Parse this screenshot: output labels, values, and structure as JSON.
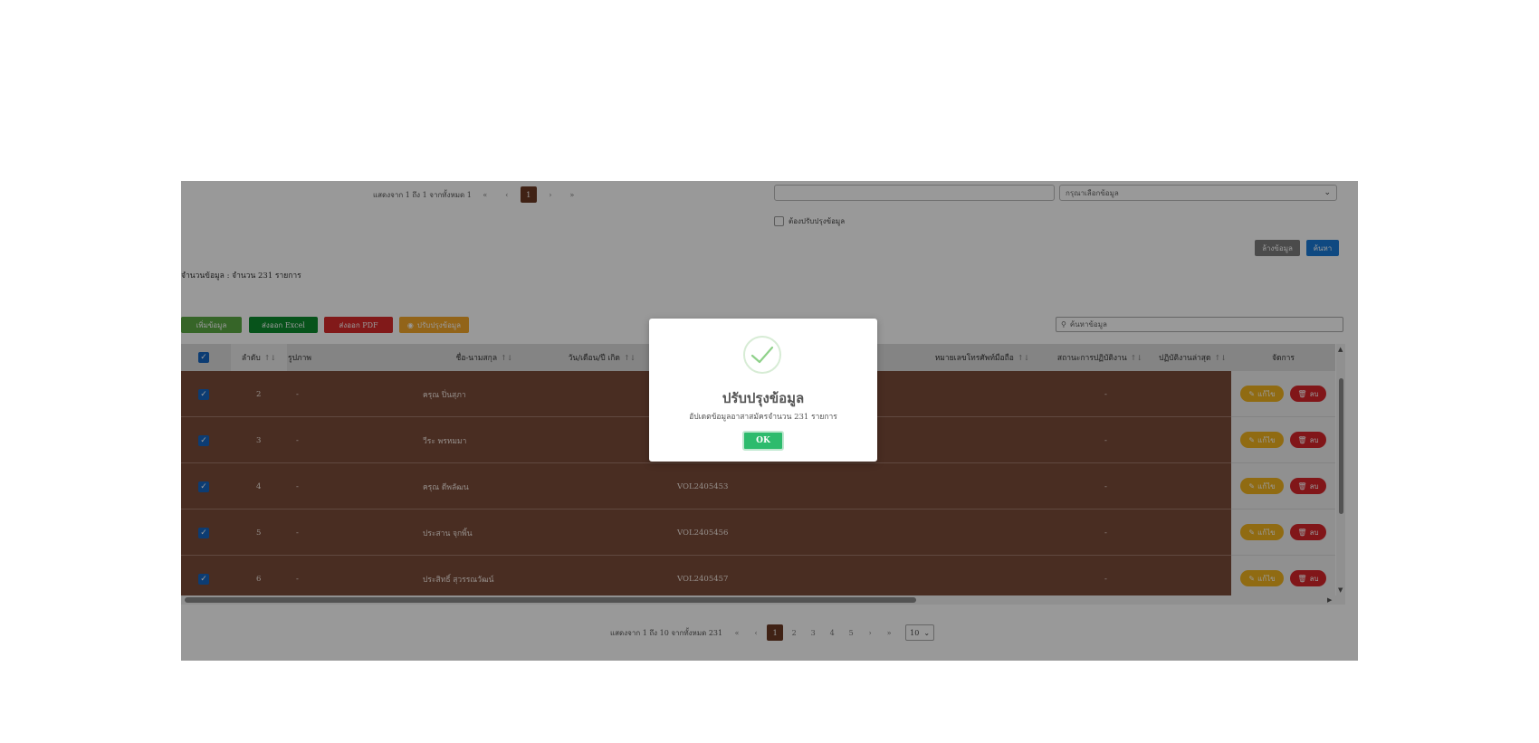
{
  "top_filter": {
    "pager_text": "แสดงจาก 1 ถึง 1 จากทั้งหมด 1",
    "pager_first": "«",
    "pager_prev": "‹",
    "pager_current": "1",
    "pager_next": "›",
    "pager_last": "»",
    "text_input_value": "",
    "select_placeholder": "กรุณาเลือกข้อมูล",
    "checkbox_label": "ต้องปรับปรุงข้อมูล",
    "clear_button": "ล้างข้อมูล",
    "search_button": "ค้นหา"
  },
  "summary": {
    "label": "จำนวนข้อมูล :",
    "value": "จำนวน 231 รายการ"
  },
  "toolbar": {
    "add_button": "เพิ่มข้อมูล",
    "export_excel": "ส่งออก Excel",
    "export_pdf": "ส่งออก PDF",
    "update_button": "ปรับปรุงข้อมูล",
    "search_placeholder": "ค้นหาข้อมูล"
  },
  "table": {
    "headers": {
      "order": "ลำดับ",
      "photo": "รูปภาพ",
      "name": "ชื่อ-นามสกุล",
      "birthdate": "วัน/เดือน/ปี เกิด",
      "phone": "หมายเลขโทรศัพท์มือถือ",
      "status": "สถานะการปฏิบัติงาน",
      "operator": "ปฏิบัติงานล่าสุด",
      "manage": "จัดการ"
    },
    "edit_label": "แก้ไข",
    "delete_label": "ลบ",
    "rows": [
      {
        "order": "2",
        "photo": "-",
        "name": "ครุณ ปิ่นสุภา",
        "code": "",
        "status": "-"
      },
      {
        "order": "3",
        "photo": "-",
        "name": "วีระ พรหมมา",
        "code": "",
        "status": "-"
      },
      {
        "order": "4",
        "photo": "-",
        "name": "ครุณ ดีพลัฒน",
        "code": "VOL2405453",
        "status": "-"
      },
      {
        "order": "5",
        "photo": "-",
        "name": "ประสาน จุกพิ้น",
        "code": "VOL2405456",
        "status": "-"
      },
      {
        "order": "6",
        "photo": "-",
        "name": "ประสิทธิ์ สุวรรณวัฒน์",
        "code": "VOL2405457",
        "status": "-"
      }
    ]
  },
  "bottom_pager": {
    "text": "แสดงจาก 1 ถึง 10 จากทั้งหมด 231",
    "first": "«",
    "prev": "‹",
    "pages": [
      "1",
      "2",
      "3",
      "4",
      "5"
    ],
    "next": "›",
    "last": "»",
    "page_size": "10"
  },
  "modal": {
    "title": "ปรับปรุงข้อมูล",
    "message": "อัปเดตข้อมูลอาสาสมัครจำนวน 231 รายการ",
    "ok_button": "OK"
  },
  "colors": {
    "row_bg": "#7a4b3a",
    "export_excel": "#0d8a2e",
    "export_pdf": "#d72b2b",
    "update": "#f4a72a",
    "add": "#5aa844",
    "search_btn": "#1a7ad8",
    "ok": "#2dbb6d"
  }
}
